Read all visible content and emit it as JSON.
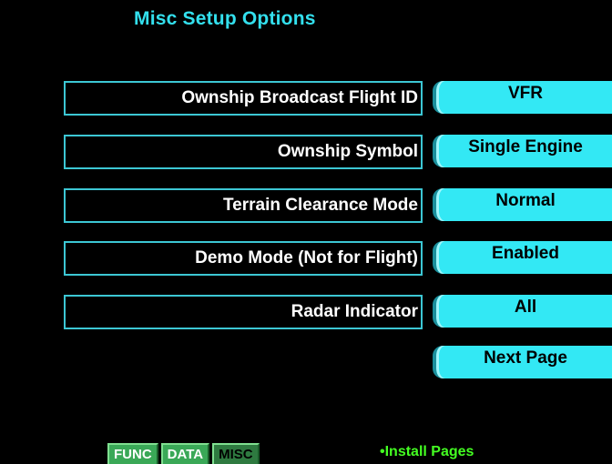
{
  "page": {
    "title": "Misc Setup Options"
  },
  "options": [
    {
      "label": "Ownship Broadcast Flight ID",
      "value": "VFR"
    },
    {
      "label": "Ownship Symbol",
      "value": "Single Engine"
    },
    {
      "label": "Terrain Clearance Mode",
      "value": "Normal"
    },
    {
      "label": "Demo Mode (Not for Flight)",
      "value": "Enabled"
    },
    {
      "label": "Radar Indicator",
      "value": "All"
    }
  ],
  "next_page_label": "Next Page",
  "softkeys": [
    {
      "label": "FUNC"
    },
    {
      "label": "DATA"
    },
    {
      "label": "MISC"
    }
  ],
  "footer": {
    "install_pages": "•Install Pages"
  },
  "colors": {
    "cyan": "#33e8f4",
    "border": "#3cc7d4",
    "green": "#44ff22",
    "softkey": "#3aa857"
  }
}
